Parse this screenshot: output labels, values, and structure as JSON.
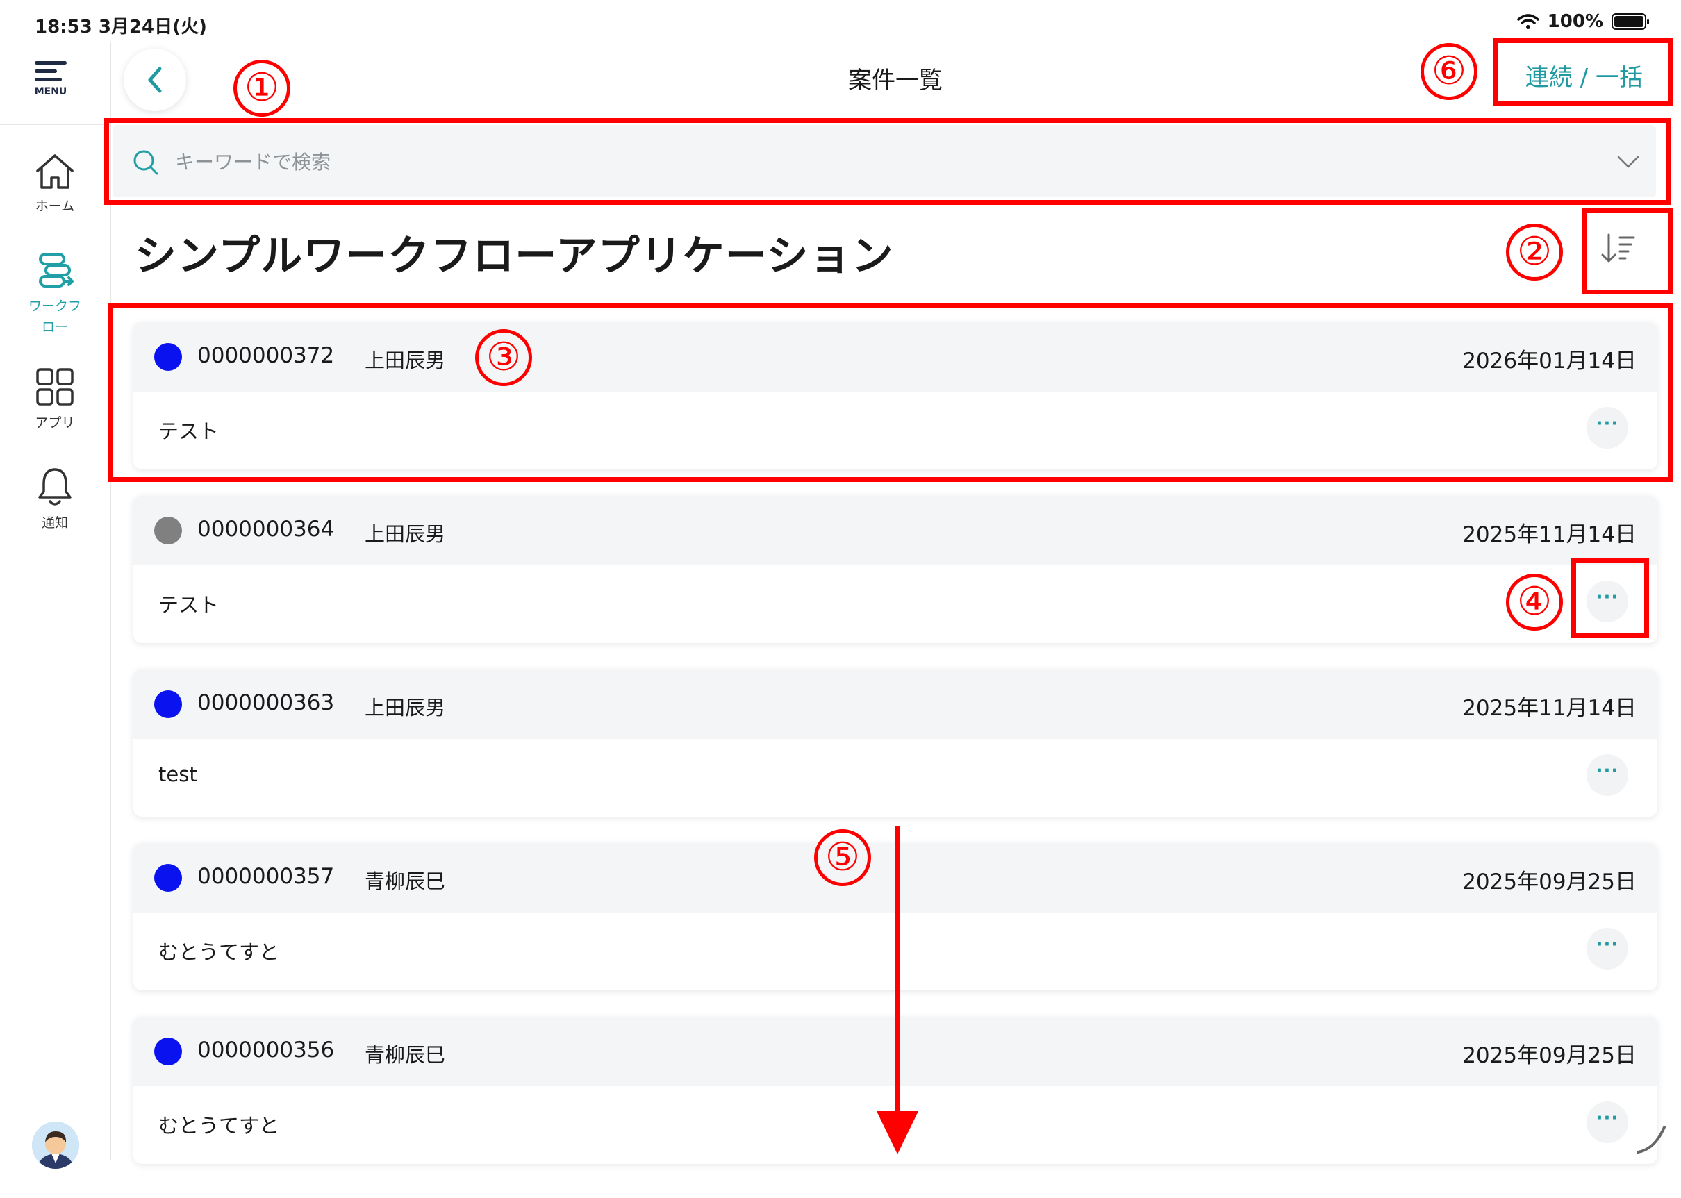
{
  "status_bar": {
    "time_date": "18:53  3月24日(火)",
    "battery_pct": "100%"
  },
  "sidebar": {
    "menu_label": "MENU",
    "items": [
      {
        "label": "ホーム",
        "icon": "home-icon"
      },
      {
        "label": "ワークフロー",
        "icon": "workflow-icon",
        "active": true
      },
      {
        "label": "アプリ",
        "icon": "apps-grid-icon"
      },
      {
        "label": "通知",
        "icon": "bell-icon"
      }
    ]
  },
  "header": {
    "title": "案件一覧",
    "bulk_link": "連続 / 一括"
  },
  "search": {
    "placeholder": "キーワードで検索"
  },
  "section": {
    "title": "シンプルワークフローアプリケーション"
  },
  "cases": [
    {
      "id": "0000000372",
      "user": "上田辰男",
      "date": "2026年01月14日",
      "title": "テスト",
      "status_color": "#0a12f0",
      "more": "···"
    },
    {
      "id": "0000000364",
      "user": "上田辰男",
      "date": "2025年11月14日",
      "title": "テスト",
      "status_color": "#808080",
      "more": "···"
    },
    {
      "id": "0000000363",
      "user": "上田辰男",
      "date": "2025年11月14日",
      "title": "test",
      "status_color": "#0a12f0",
      "more": "···"
    },
    {
      "id": "0000000357",
      "user": "青柳辰巳",
      "date": "2025年09月25日",
      "title": "むとうてすと",
      "status_color": "#0a12f0",
      "more": "···"
    },
    {
      "id": "0000000356",
      "user": "青柳辰巳",
      "date": "2025年09月25日",
      "title": "むとうてすと",
      "status_color": "#0a12f0",
      "more": "···"
    }
  ],
  "annotations": {
    "n1": "①",
    "n2": "②",
    "n3": "③",
    "n4": "④",
    "n5": "⑤",
    "n6": "⑥"
  },
  "colors": {
    "accent": "#1f9aa3",
    "annotation": "#ff0000"
  }
}
